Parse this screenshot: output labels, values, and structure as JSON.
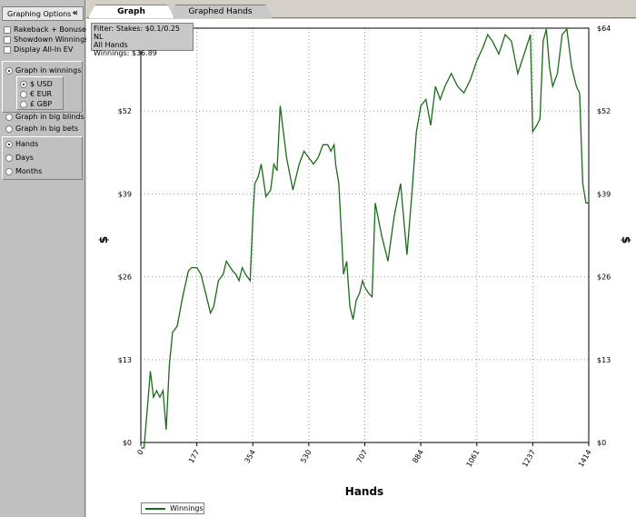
{
  "sidebar": {
    "header_title": "Graphing Options",
    "collapse_glyph": "«",
    "checkboxes": [
      "Rakeback + Bonuses",
      "Showdown Winnings",
      "Display All-In EV"
    ],
    "graph_modes": [
      "Graph in winnings",
      "Graph in big blinds",
      "Graph in big bets"
    ],
    "selected_graph_mode": "Graph in winnings",
    "currencies": [
      "$ USD",
      "€ EUR",
      "£ GBP"
    ],
    "selected_currency": "$ USD",
    "x_units": [
      "Hands",
      "Days",
      "Months"
    ],
    "selected_x_unit": "Hands"
  },
  "tabs": [
    {
      "label": "Graph",
      "active": true
    },
    {
      "label": "Graphed Hands",
      "active": false
    }
  ],
  "filter_box": {
    "line1": "Filter: Stakes: $0.1/0.25 NL",
    "line2": "All Hands",
    "line3": "Winnings: $36.89"
  },
  "colors": {
    "series": "#1a6b1a",
    "grid": "#9a9a9a",
    "axis": "#000000"
  },
  "chart_data": {
    "type": "line",
    "xlabel": "Hands",
    "ylabel": "$",
    "xlim": [
      0,
      1414
    ],
    "ylim": [
      0,
      64
    ],
    "x_ticks": [
      "0",
      "177",
      "354",
      "530",
      "707",
      "884",
      "1061",
      "1237",
      "1414"
    ],
    "y_ticks": [
      "$0",
      "$13",
      "$26",
      "$39",
      "$52",
      "$64"
    ],
    "grid": true,
    "legend": "bottom-left",
    "series": [
      {
        "name": "Winnings",
        "x": [
          0,
          10,
          20,
          30,
          40,
          50,
          60,
          70,
          80,
          90,
          100,
          115,
          130,
          150,
          160,
          177,
          190,
          200,
          210,
          220,
          230,
          245,
          260,
          270,
          290,
          300,
          310,
          320,
          330,
          345,
          354,
          360,
          370,
          380,
          395,
          410,
          420,
          430,
          440,
          460,
          480,
          500,
          515,
          530,
          545,
          560,
          575,
          590,
          600,
          610,
          615,
          625,
          640,
          650,
          660,
          670,
          680,
          690,
          700,
          707,
          720,
          730,
          740,
          760,
          780,
          800,
          820,
          840,
          855,
          870,
          884,
          900,
          915,
          930,
          945,
          960,
          980,
          1000,
          1020,
          1040,
          1061,
          1080,
          1095,
          1110,
          1130,
          1150,
          1170,
          1190,
          1210,
          1230,
          1237,
          1250,
          1260,
          1270,
          1280,
          1290,
          1300,
          1315,
          1330,
          1345,
          1360,
          1375,
          1385,
          1395,
          1405,
          1414
        ],
        "y": [
          -1,
          -1,
          5,
          11,
          7,
          8,
          7,
          8,
          2,
          12,
          17,
          18,
          22,
          26.5,
          27,
          27,
          26,
          24,
          22,
          20,
          21,
          25,
          26,
          28,
          26.5,
          26,
          25,
          27,
          26,
          25,
          35,
          40,
          41,
          43,
          38,
          39,
          43,
          42,
          52,
          44,
          39,
          43,
          45,
          44,
          43,
          44,
          46,
          46,
          45,
          46,
          43,
          40,
          26,
          28,
          21,
          19,
          22,
          23,
          25,
          24,
          23,
          22.5,
          37,
          32,
          28,
          35,
          40,
          29,
          38,
          48,
          52,
          53,
          49,
          55,
          53,
          55,
          57,
          55,
          54,
          56,
          59,
          61,
          63,
          62,
          60,
          63,
          62,
          57,
          60,
          63,
          48,
          49,
          50,
          62,
          65,
          58,
          55,
          57,
          63,
          64,
          58,
          55,
          54,
          40,
          37,
          37
        ]
      }
    ]
  }
}
